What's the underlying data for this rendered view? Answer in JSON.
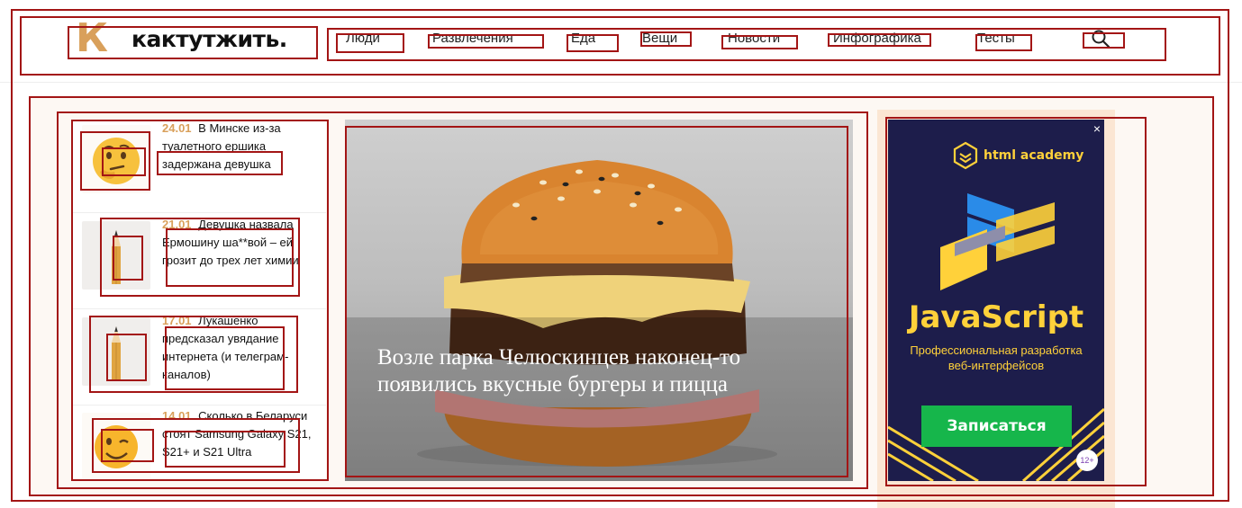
{
  "site": {
    "logo_text": "кактутжить.",
    "logo_letter": "К"
  },
  "nav": {
    "items": [
      "Люди",
      "Развлечения",
      "Еда",
      "Вещи",
      "Новости",
      "Инфографика",
      "Тесты"
    ]
  },
  "news": [
    {
      "date": "24.01",
      "title": "В Минске из-за туалетного ершика задержана девушка",
      "icon": "thinking-face-emoji"
    },
    {
      "date": "21.01",
      "title": "Девушка назвала Ермошину ша**вой – ей грозит до трех лет химии",
      "icon": "pencil-icon"
    },
    {
      "date": "17.01",
      "title": "Лукашенко предсказал увядание интернета (и телеграм-каналов)",
      "icon": "pencil-icon"
    },
    {
      "date": "14.01",
      "title": "Сколько в Беларуси стоят Samsung Galaxy S21, S21+ и S21 Ultra",
      "icon": "winking-face-emoji"
    }
  ],
  "hero": {
    "title": "Возле парка Челюскинцев наконец-то появились вкусные бургеры и пицца"
  },
  "ad": {
    "brand": "html academy",
    "title": "JavaScript",
    "subtitle_line1": "Профессиональная разработка",
    "subtitle_line2": "веб-интерфейсов",
    "button": "Записаться",
    "age": "12+",
    "close": "×"
  },
  "colors": {
    "accent": "#d9a05b",
    "ad_bg": "#1d1d4b",
    "ad_yellow": "#ffd13a",
    "ad_button": "#16b64b",
    "annotation": "#a31515"
  }
}
